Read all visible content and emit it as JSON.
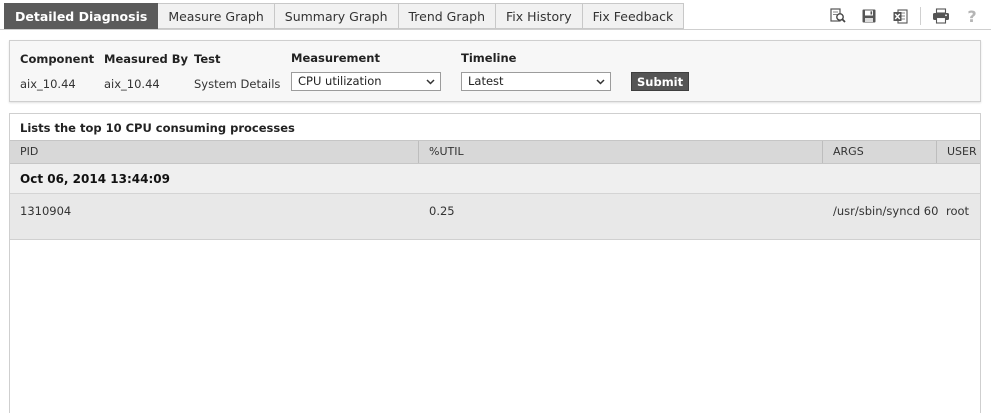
{
  "tabs": [
    {
      "label": "Detailed Diagnosis",
      "active": true
    },
    {
      "label": "Measure Graph",
      "active": false
    },
    {
      "label": "Summary Graph",
      "active": false
    },
    {
      "label": "Trend Graph",
      "active": false
    },
    {
      "label": "Fix History",
      "active": false
    },
    {
      "label": "Fix Feedback",
      "active": false
    }
  ],
  "toolbar": {
    "icons": [
      "search-report-icon",
      "save-icon",
      "excel-export-icon",
      "print-icon",
      "help-icon"
    ],
    "help_glyph": "?"
  },
  "filter": {
    "component": {
      "label": "Component",
      "value": "aix_10.44"
    },
    "measured_by": {
      "label": "Measured By",
      "value": "aix_10.44"
    },
    "test": {
      "label": "Test",
      "value": "System Details"
    },
    "measurement": {
      "label": "Measurement",
      "selected": "CPU utilization"
    },
    "timeline": {
      "label": "Timeline",
      "selected": "Latest"
    },
    "submit_label": "Submit"
  },
  "results": {
    "caption": "Lists the top 10 CPU consuming processes",
    "columns": [
      "PID",
      "%UTIL",
      "ARGS",
      "USER"
    ],
    "group": "Oct 06, 2014 13:44:09",
    "rows": [
      {
        "pid": "1310904",
        "util": "0.25",
        "args": "/usr/sbin/syncd 60",
        "user": "root"
      }
    ]
  },
  "colors": {
    "active_tab": "#5b5b5b",
    "header_bg": "#d8d8d8",
    "row_bg": "#e8e8e8",
    "submit_bg": "#555555"
  }
}
